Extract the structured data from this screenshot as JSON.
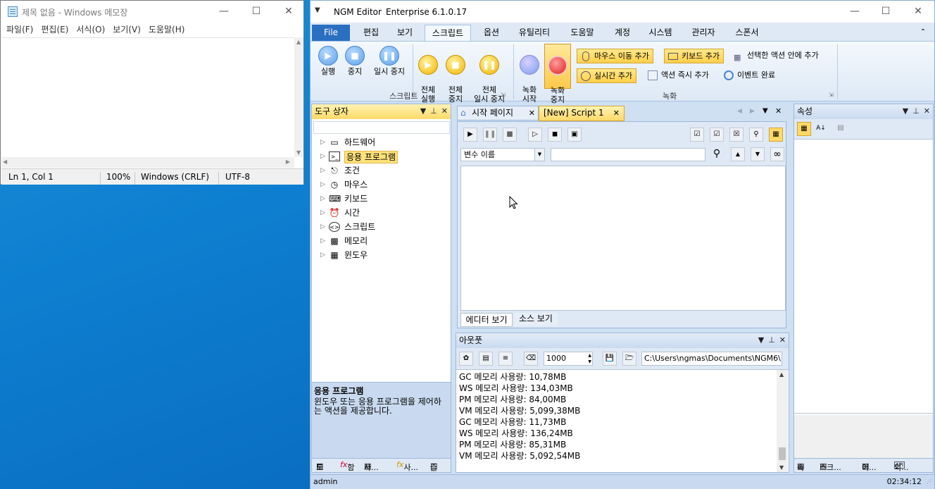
{
  "notepad": {
    "title": "제목 없음 - Windows 메모장",
    "menu": [
      "파일(F)",
      "편집(E)",
      "서식(O)",
      "보기(V)",
      "도움말(H)"
    ],
    "status": {
      "position": "Ln 1, Col 1",
      "zoom": "100%",
      "line_ending": "Windows (CRLF)",
      "encoding": "UTF-8"
    }
  },
  "ngm": {
    "app_name": "NGM Editor",
    "version": "Enterprise 6.1.0.17",
    "tabs": [
      "File",
      "편집",
      "보기",
      "스크립트",
      "옵션",
      "유틸리티",
      "도움말",
      "계정",
      "시스템",
      "관리자",
      "스폰서"
    ],
    "ribbon": {
      "script_group": "스크립트",
      "record_group": "녹화",
      "run": "실행",
      "stop": "중지",
      "pause": "일시 중지",
      "run_all": "전체\n실행",
      "stop_all": "전체\n중지",
      "pause_all": "전체\n일시 중지",
      "record_start": "녹화\n시작",
      "record_stop": "녹화\n중지",
      "add_mouse_move": "마우스 이동 추가",
      "add_keyboard": "키보드 추가",
      "add_in_selected": "선택한 액션 안에 추가",
      "add_realtime": "실시간 추가",
      "add_action_now": "액션 즉시 추가",
      "event_complete": "이벤트 완료"
    },
    "toolbox": {
      "title": "도구 상자",
      "items": [
        "하드웨어",
        "응용 프로그램",
        "조건",
        "마우스",
        "키보드",
        "시간",
        "스크립트",
        "메모리",
        "윈도우"
      ],
      "desc_title": "응용 프로그램",
      "desc_text": "윈도우 또는 응용 프로그램을 제어하는 액션을 제공합니다.",
      "bottom_tabs": [
        "도",
        "함",
        "사...",
        "사...",
        "즐"
      ]
    },
    "doc_tabs": {
      "start_page": "시작 페이지",
      "script": "[New] Script 1"
    },
    "editor": {
      "var_select": "변수 이름",
      "search_value": "",
      "view_editor": "에디터 보기",
      "view_source": "소스 보기"
    },
    "output": {
      "title": "아웃풋",
      "count": "1000",
      "path": "C:\\Users\\ngmas\\Documents\\NGM6\\",
      "lines": [
        "GC 메모리 사용량: 10,78MB",
        "WS 메모리 사용량: 134,03MB",
        "PM 메모리 사용량: 84,00MB",
        "VM 메모리 사용량: 5,099,38MB",
        "GC 메모리 사용량: 11,73MB",
        "WS 메모리 사용량: 136,24MB",
        "PM 메모리 사용량: 85,31MB",
        "VM 메모리 사용량: 5,092,54MB"
      ]
    },
    "properties": {
      "title": "속성",
      "bottom_tabs": [
        "속",
        "스크...",
        "이...",
        "외..."
      ]
    },
    "status": {
      "user": "admin",
      "time": "02:34:12"
    }
  }
}
